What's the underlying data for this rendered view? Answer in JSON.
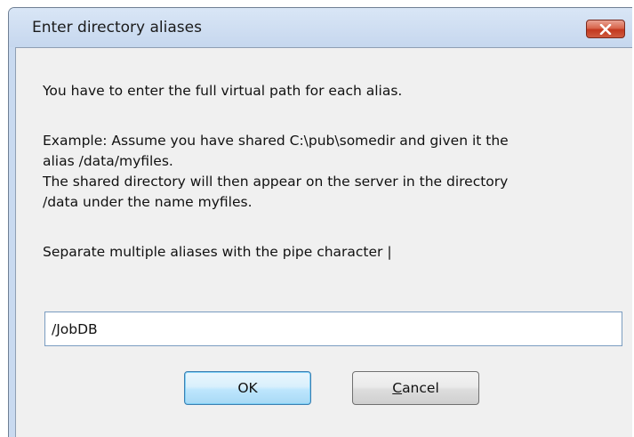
{
  "dialog": {
    "title": "Enter directory aliases",
    "close_label": "close"
  },
  "message": {
    "line1": "You have to enter the full virtual path for each alias.",
    "line2": "Example: Assume you have shared C:\\pub\\somedir and given it the",
    "line3": "alias /data/myfiles.",
    "line4": "The shared directory will then appear on the server in the directory",
    "line5": "/data under the name myfiles.",
    "line6": "Separate multiple aliases with the pipe character |"
  },
  "alias_input": {
    "value": "/JobDB"
  },
  "buttons": {
    "ok_label": "OK",
    "cancel_accel": "C",
    "cancel_rest": "ancel"
  },
  "colors": {
    "close_button": "#c2381f",
    "ok_border": "#3c7fb1",
    "frame": "#c9daf0"
  }
}
